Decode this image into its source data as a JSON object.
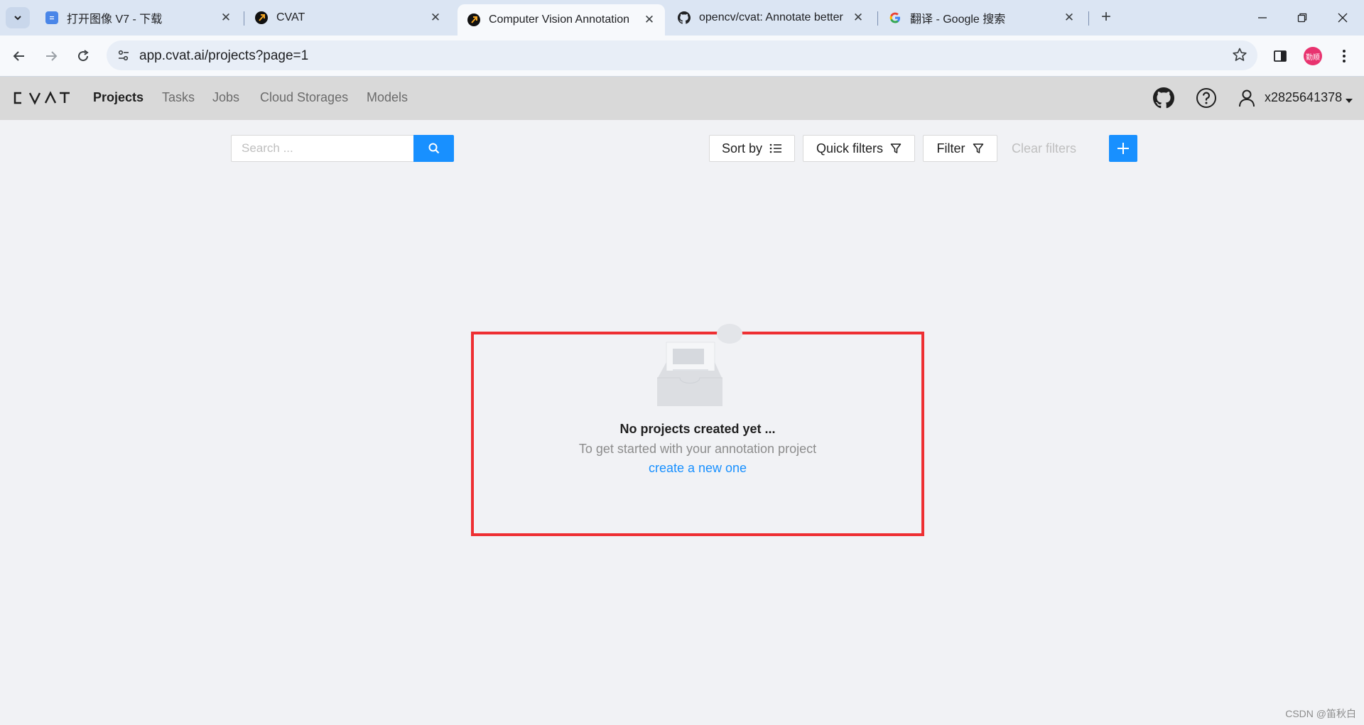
{
  "browser": {
    "tabs": [
      {
        "title": "打开图像 V7 - 下载",
        "favicon": "google-docs-icon",
        "active": false
      },
      {
        "title": "CVAT",
        "favicon": "cvat-icon",
        "active": false
      },
      {
        "title": "Computer Vision Annotation",
        "favicon": "cvat-icon",
        "active": true
      },
      {
        "title": "opencv/cvat: Annotate better",
        "favicon": "github-icon",
        "active": false
      },
      {
        "title": "翻译 - Google 搜索",
        "favicon": "google-icon",
        "active": false
      }
    ],
    "new_tab_label": "+",
    "url": "app.cvat.ai/projects?page=1",
    "profile_badge": "勤顺"
  },
  "header": {
    "logo": "CVAT",
    "nav": [
      "Projects",
      "Tasks",
      "Jobs",
      "Cloud Storages",
      "Models"
    ],
    "active_nav": "Projects",
    "username": "x2825641378"
  },
  "filters": {
    "search_placeholder": "Search ...",
    "search_value": "",
    "sort_label": "Sort by",
    "quick_filters_label": "Quick filters",
    "filter_label": "Filter",
    "clear_filters_label": "Clear filters"
  },
  "empty_state": {
    "title": "No projects created yet ...",
    "description": "To get started with your annotation project",
    "link": "create a new one"
  },
  "watermark": "CSDN @笛秋白",
  "colors": {
    "accent": "#1890ff",
    "highlight": "#ee2f32",
    "header_bg": "#d9d9d9",
    "page_bg": "#f1f2f5"
  }
}
